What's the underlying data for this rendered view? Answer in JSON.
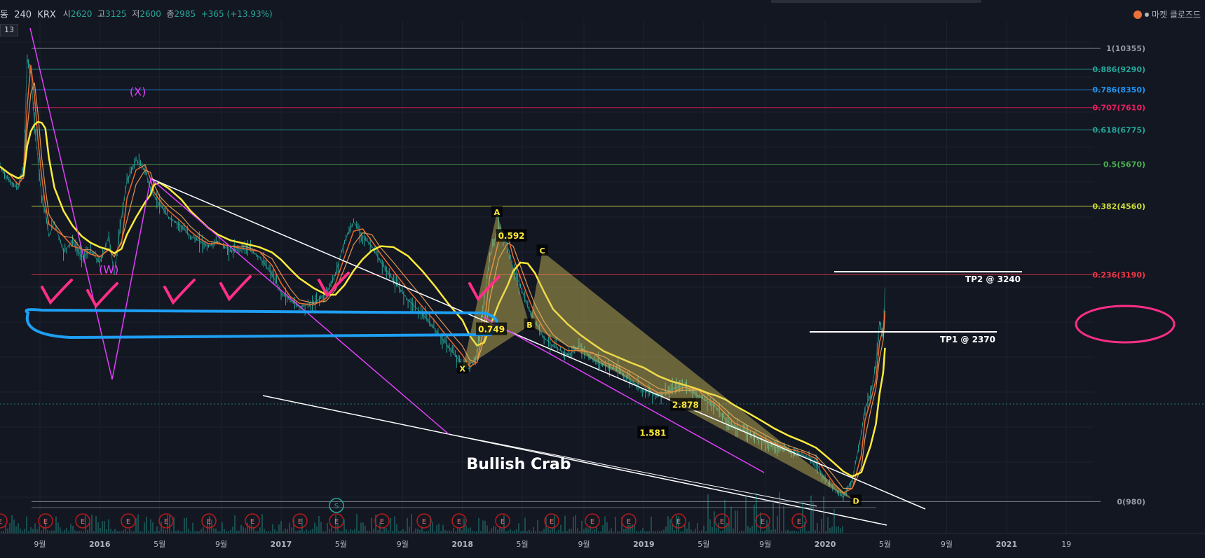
{
  "header": {
    "symbol": "동",
    "interval": "240",
    "exchange": "KRX",
    "open_label": "시",
    "open": "2620",
    "high_label": "고",
    "high": "3125",
    "low_label": "저",
    "low": "2600",
    "close_label": "종",
    "close": "2985",
    "change": "+365 (+13.93%)",
    "badge": "13"
  },
  "market_status": "마켓 클로즈드",
  "colors": {
    "background": "#131722",
    "grid": "#1e2230",
    "candles": "#26a69a",
    "ma_fast": "#e86a2e",
    "ma_slow": "#ffeb3b",
    "ma_mid": "#f4a25a",
    "wave": "#e040fb",
    "trend": "#ffffff",
    "marker": "#ff2e88",
    "highlight_box": "#1e9ff2",
    "pattern_fill": "#d4c45c"
  },
  "chart_data": {
    "type": "line",
    "title": "",
    "xlabel": "",
    "ylabel": "",
    "y_scale": "log",
    "ylim": [
      830,
      11600
    ],
    "x_ticks": [
      "9월",
      "2016",
      "5월",
      "9월",
      "2017",
      "5월",
      "9월",
      "2018",
      "5월",
      "9월",
      "2019",
      "5월",
      "9월",
      "2020",
      "5월",
      "9월",
      "2021",
      "19"
    ],
    "x_tick_times": [
      2015.67,
      2016.0,
      2016.33,
      2016.67,
      2017.0,
      2017.33,
      2017.67,
      2018.0,
      2018.33,
      2018.67,
      2019.0,
      2019.33,
      2019.67,
      2020.0,
      2020.33,
      2020.67,
      2021.0,
      2021.33
    ],
    "xlim": [
      2015.45,
      2021.48
    ],
    "series": [
      {
        "type": "line",
        "x": [
          2015.45,
          2015.5,
          2015.55,
          2015.58,
          2015.6,
          2015.62,
          2015.64,
          2015.66,
          2015.68,
          2015.7,
          2015.72,
          2015.75,
          2015.8,
          2015.85,
          2015.9,
          2015.95,
          2016.0,
          2016.05,
          2016.08,
          2016.12,
          2016.15,
          2016.2,
          2016.25,
          2016.28,
          2016.3,
          2016.33,
          2016.38,
          2016.45,
          2016.5,
          2016.55,
          2016.6,
          2016.65,
          2016.72,
          2016.8,
          2016.88,
          2016.95,
          2017.0,
          2017.05,
          2017.1,
          2017.18,
          2017.25,
          2017.3,
          2017.35,
          2017.4,
          2017.45,
          2017.5,
          2017.55,
          2017.62,
          2017.7,
          2017.78,
          2017.85,
          2017.92,
          2018.0,
          2018.04,
          2018.08,
          2018.12,
          2018.15,
          2018.2,
          2018.25,
          2018.28,
          2018.32,
          2018.36,
          2018.4,
          2018.45,
          2018.5,
          2018.58,
          2018.65,
          2018.72,
          2018.78,
          2018.85,
          2018.92,
          2019.0,
          2019.08,
          2019.15,
          2019.22,
          2019.3,
          2019.35,
          2019.4,
          2019.45,
          2019.5,
          2019.58,
          2019.65,
          2019.72,
          2019.8,
          2019.88,
          2019.95,
          2020.0,
          2020.05,
          2020.1,
          2020.15,
          2020.2,
          2020.22,
          2020.25,
          2020.28,
          2020.3,
          2020.32,
          2020.33
        ],
        "y": [
          5600,
          5200,
          5000,
          5600,
          9800,
          9200,
          7000,
          5800,
          4800,
          4400,
          3900,
          4200,
          3600,
          3800,
          3500,
          3600,
          3400,
          3900,
          3200,
          4300,
          5200,
          5800,
          5500,
          5000,
          4800,
          4600,
          4300,
          4100,
          3900,
          3800,
          3700,
          3800,
          3600,
          3700,
          3500,
          3200,
          2900,
          2800,
          2700,
          2750,
          2900,
          3200,
          3800,
          4200,
          3900,
          3700,
          3400,
          3100,
          2800,
          2600,
          2400,
          2200,
          2000,
          1950,
          2100,
          2800,
          3500,
          4100,
          3700,
          3300,
          3000,
          2700,
          2500,
          2300,
          2200,
          2100,
          2200,
          2050,
          2000,
          1950,
          1850,
          1750,
          1700,
          1750,
          1800,
          1700,
          1650,
          1600,
          1500,
          1450,
          1400,
          1350,
          1300,
          1280,
          1250,
          1200,
          1100,
          1050,
          1000,
          1100,
          1400,
          1600,
          1700,
          2000,
          2500,
          2300,
          2985
        ]
      },
      {
        "name": "",
        "type": "ma",
        "color": "#ffeb3b"
      },
      {
        "name": "",
        "type": "ma",
        "color": "#e86a2e"
      }
    ],
    "fib_levels": [
      {
        "ratio": "1",
        "price": "10355",
        "color": "#9598a1"
      },
      {
        "ratio": "0.886",
        "price": "9290",
        "color": "#26a69a"
      },
      {
        "ratio": "0.786",
        "price": "8350",
        "color": "#2196f3"
      },
      {
        "ratio": "0.707",
        "price": "7610",
        "color": "#e91e63"
      },
      {
        "ratio": "0.618",
        "price": "6775",
        "color": "#26a69a"
      },
      {
        "ratio": "0.5",
        "price": "5670",
        "color": "#4caf50"
      },
      {
        "ratio": "0.382",
        "price": "4560",
        "color": "#cddc39"
      },
      {
        "ratio": "0.236",
        "price": "3190",
        "color": "#f23645"
      },
      {
        "ratio": "0",
        "price": "980",
        "color": "#9598a1"
      }
    ],
    "targets": [
      {
        "label": "TP2 @ 3240",
        "price": 3240
      },
      {
        "label": "TP1 @ 2370",
        "price": 2370
      }
    ],
    "annotations": {
      "pattern_title": "Bullish Crab",
      "points": [
        {
          "label": "X",
          "x": 2018.0,
          "price": 1950
        },
        {
          "label": "A",
          "x": 2018.19,
          "price": 4400
        },
        {
          "label": "B",
          "x": 2018.37,
          "price": 2450
        },
        {
          "label": "C",
          "x": 2018.44,
          "price": 3600
        },
        {
          "label": "D",
          "x": 2020.17,
          "price": 980
        }
      ],
      "ratios": [
        {
          "label": "0.592",
          "x": 2018.27,
          "price": 3900
        },
        {
          "label": "0.749",
          "x": 2018.16,
          "price": 2400
        },
        {
          "label": "1.581",
          "x": 2019.05,
          "price": 1400
        },
        {
          "label": "2.878",
          "x": 2019.23,
          "price": 1620
        }
      ],
      "waves": [
        {
          "label": "(X)",
          "x": 2016.21,
          "price": 7700
        },
        {
          "label": "(W)",
          "x": 2016.05,
          "price": 3050
        }
      ],
      "event_letter": "E",
      "split_letter": "S"
    }
  }
}
